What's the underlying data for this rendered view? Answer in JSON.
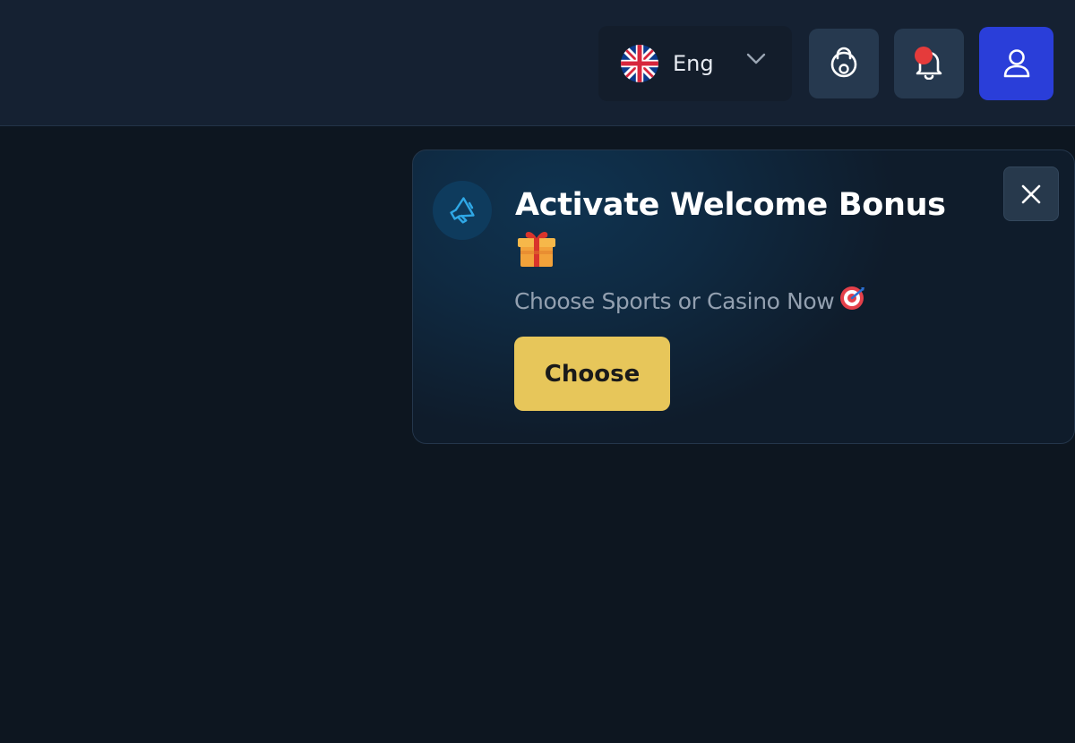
{
  "header": {
    "language": {
      "label": "Eng",
      "flag": "uk-flag-icon"
    },
    "buttons": {
      "settings": "gear-lock-icon",
      "notifications": "bell-icon",
      "profile": "user-icon"
    }
  },
  "toast": {
    "title": "Activate Welcome Bonus",
    "title_emoji": "gift",
    "subtitle": "Choose Sports or Casino Now",
    "subtitle_emoji": "target",
    "cta_label": "Choose",
    "close": "close-icon"
  },
  "colors": {
    "accent_yellow": "#e7c65a",
    "profile_blue": "#2a3ed9",
    "notification_red": "#e53b3b"
  }
}
